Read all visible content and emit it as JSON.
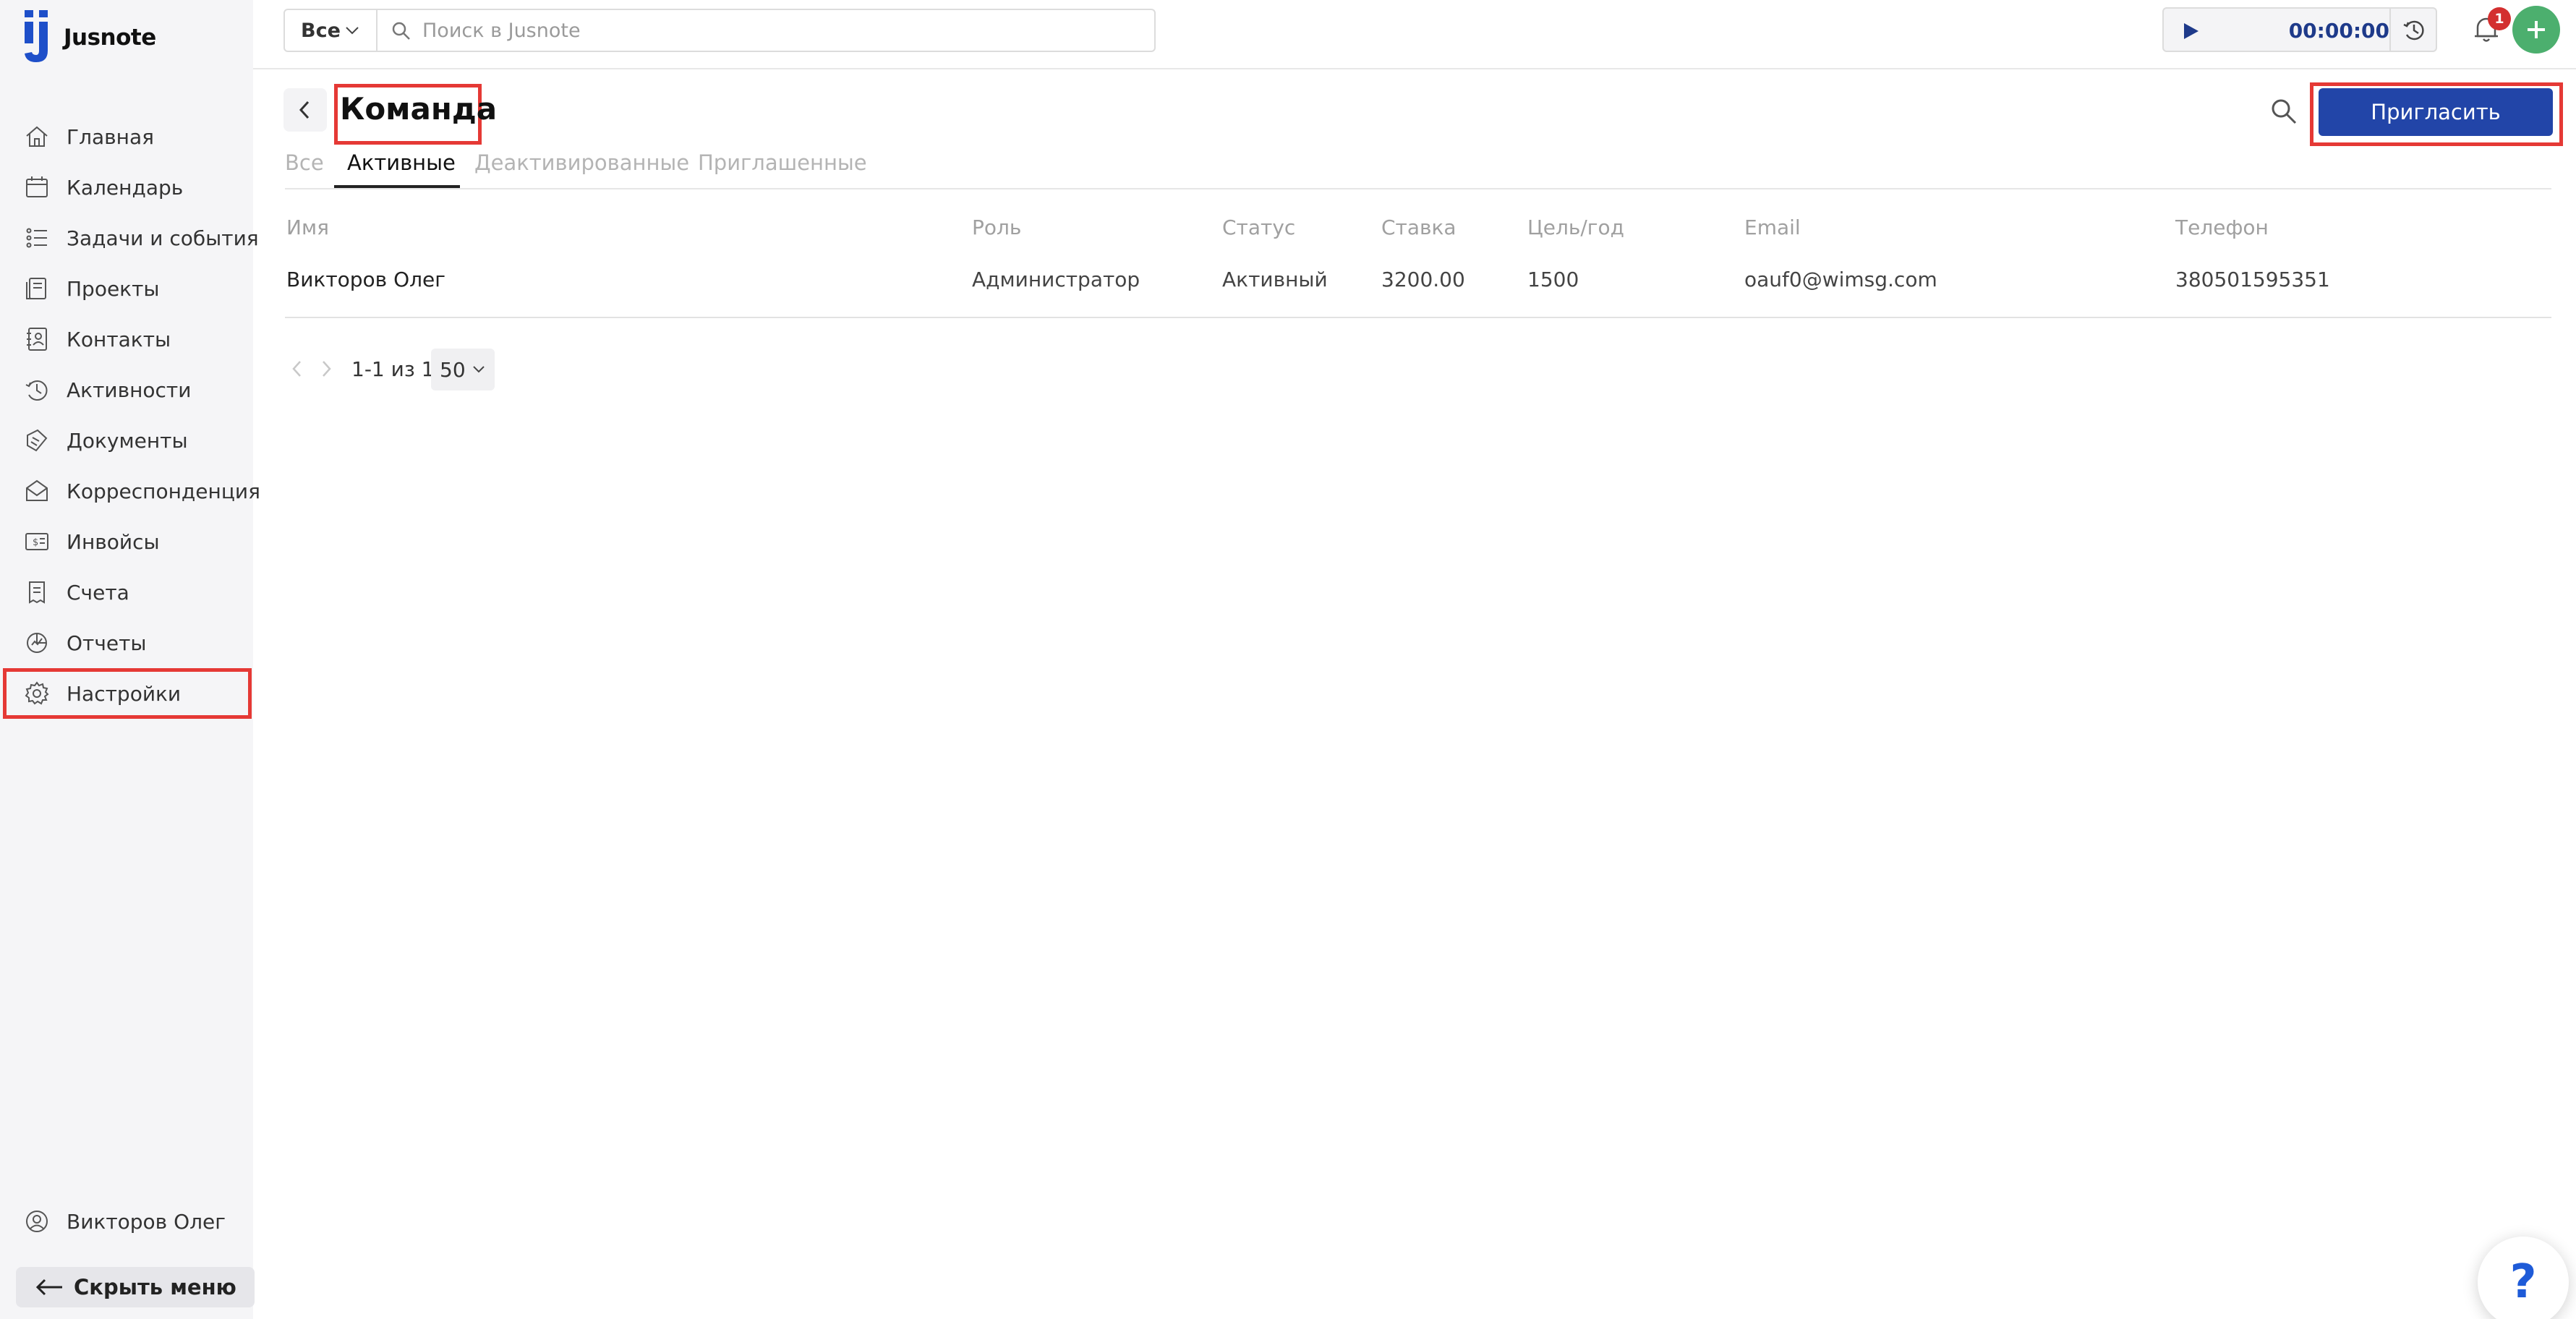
{
  "app": {
    "name": "Jusnote"
  },
  "colors": {
    "accent": "#2245a8",
    "highlight": "#e53935",
    "plus": "#4caf6e",
    "badge": "#d32f2f"
  },
  "sidebar": {
    "items": [
      {
        "label": "Главная",
        "icon": "home-icon"
      },
      {
        "label": "Календарь",
        "icon": "calendar-icon"
      },
      {
        "label": "Задачи и события",
        "icon": "tasks-icon"
      },
      {
        "label": "Проекты",
        "icon": "projects-icon"
      },
      {
        "label": "Контакты",
        "icon": "contacts-icon"
      },
      {
        "label": "Активности",
        "icon": "activity-icon"
      },
      {
        "label": "Документы",
        "icon": "documents-icon"
      },
      {
        "label": "Корреспонденция",
        "icon": "mail-icon"
      },
      {
        "label": "Инвойсы",
        "icon": "invoice-icon"
      },
      {
        "label": "Счета",
        "icon": "bills-icon"
      },
      {
        "label": "Отчеты",
        "icon": "reports-icon"
      },
      {
        "label": "Настройки",
        "icon": "gear-icon",
        "active": true
      }
    ],
    "user": "Викторов Олег",
    "hide_menu": "Скрыть меню"
  },
  "topbar": {
    "scope": "Все",
    "search_placeholder": "Поиск в Jusnote",
    "timer": "00:00:00",
    "notifications": "1"
  },
  "page": {
    "title": "Команда",
    "invite": "Пригласить",
    "tabs": [
      {
        "label": "Все"
      },
      {
        "label": "Активные",
        "active": true
      },
      {
        "label": "Деактивированные"
      },
      {
        "label": "Приглашенные"
      }
    ]
  },
  "table": {
    "headers": [
      "Имя",
      "Роль",
      "Статус",
      "Ставка",
      "Цель/год",
      "Email",
      "Телефон"
    ],
    "rows": [
      [
        "Викторов Олег",
        "Администратор",
        "Активный",
        "3200.00",
        "1500",
        "oauf0@wimsg.com",
        "380501595351"
      ]
    ]
  },
  "pagination": {
    "range": "1-1 из 1",
    "page_size": "50"
  },
  "help": {
    "label": "?"
  }
}
